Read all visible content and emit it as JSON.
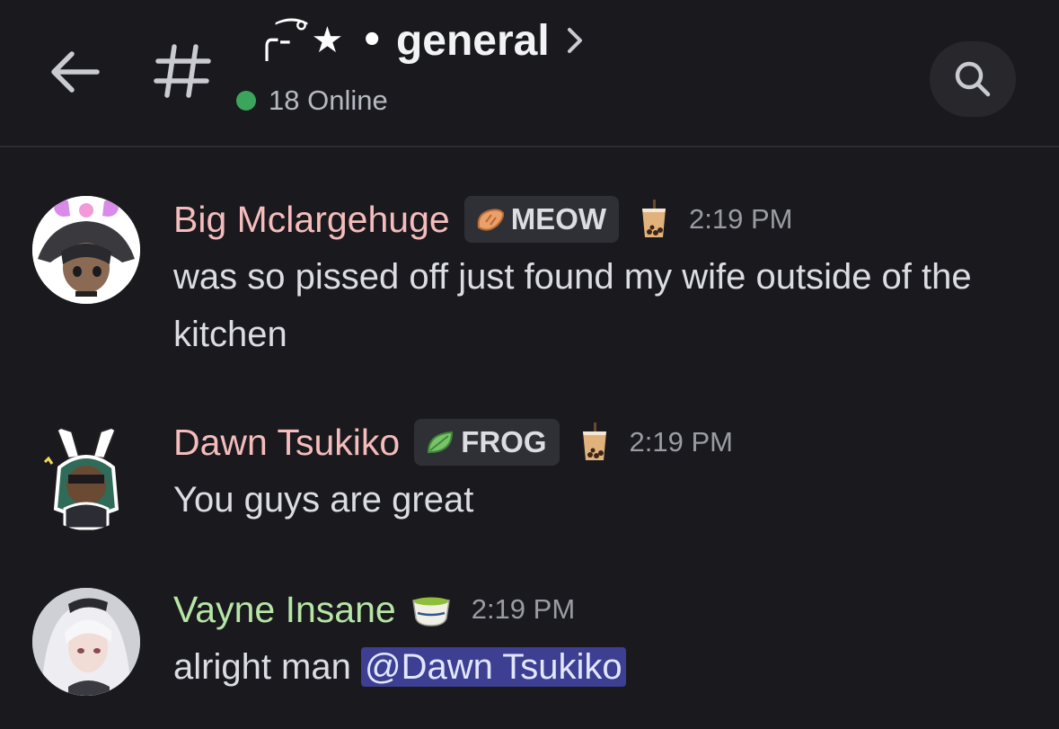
{
  "header": {
    "channel_decoration": "╭-͡˚★",
    "separator": "•",
    "channel_name": "general",
    "online_count": "18 Online"
  },
  "messages": [
    {
      "username": "Big Mclargehuge",
      "username_color": "#f5bcbc",
      "tag": "MEOW",
      "emoji": "bubble-tea-icon",
      "time": "2:19 PM",
      "text": "was so pissed off just found my wife outside of the kitchen"
    },
    {
      "username": "Dawn Tsukiko",
      "username_color": "#f5bcbc",
      "tag": "FROG",
      "emoji": "bubble-tea-icon",
      "time": "2:19 PM",
      "text": "You guys are great"
    },
    {
      "username": "Vayne Insane",
      "username_color": "#b6e6a6",
      "emoji": "green-tea-icon",
      "time": "2:19 PM",
      "text": "alright man ",
      "mention": "@Dawn Tsukiko"
    }
  ]
}
